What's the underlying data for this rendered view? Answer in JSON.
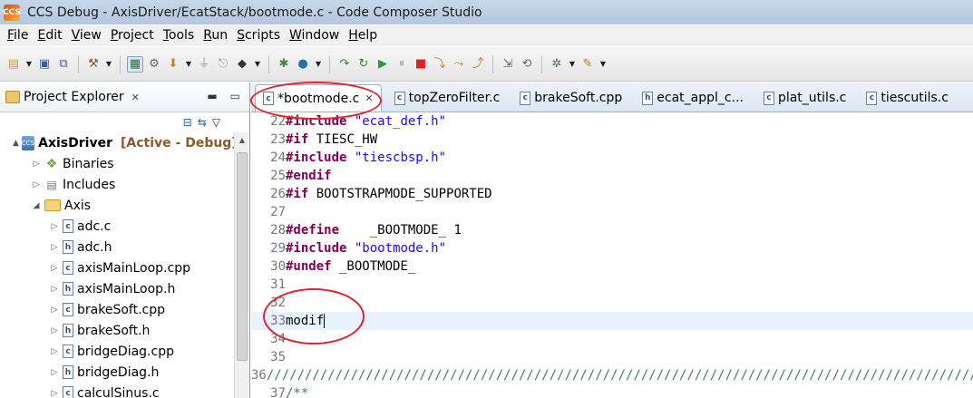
{
  "window": {
    "title": "CCS Debug - AxisDriver/EcatStack/bootmode.c - Code Composer Studio",
    "app_icon": "ccs-icon"
  },
  "menu": [
    "File",
    "Edit",
    "View",
    "Project",
    "Tools",
    "Run",
    "Scripts",
    "Window",
    "Help"
  ],
  "explorer": {
    "title": "Project Explorer",
    "tree": [
      {
        "label": "AxisDriver",
        "suffix": "[Active - Debug]",
        "icon": "project",
        "arrow": "▲",
        "indent": 0
      },
      {
        "label": "Binaries",
        "icon": "binaries",
        "arrow": "▷",
        "indent": 1
      },
      {
        "label": "Includes",
        "icon": "includes",
        "arrow": "▷",
        "indent": 1
      },
      {
        "label": "Axis",
        "icon": "folder",
        "arrow": "◢",
        "indent": 1
      },
      {
        "label": "adc.c",
        "icon": "c",
        "arrow": "▷",
        "indent": 2
      },
      {
        "label": "adc.h",
        "icon": "h",
        "arrow": "▷",
        "indent": 2
      },
      {
        "label": "axisMainLoop.cpp",
        "icon": "c",
        "arrow": "▷",
        "indent": 2
      },
      {
        "label": "axisMainLoop.h",
        "icon": "h",
        "arrow": "▷",
        "indent": 2
      },
      {
        "label": "brakeSoft.cpp",
        "icon": "c",
        "arrow": "▷",
        "indent": 2
      },
      {
        "label": "brakeSoft.h",
        "icon": "h",
        "arrow": "▷",
        "indent": 2
      },
      {
        "label": "bridgeDiag.cpp",
        "icon": "c",
        "arrow": "▷",
        "indent": 2
      },
      {
        "label": "bridgeDiag.h",
        "icon": "h",
        "arrow": "▷",
        "indent": 2
      },
      {
        "label": "calculSinus.c",
        "icon": "c",
        "arrow": "▷",
        "indent": 2
      }
    ]
  },
  "editor": {
    "tabs": [
      {
        "label": "*bootmode.c",
        "icon": "c",
        "active": true,
        "closable": true
      },
      {
        "label": "topZeroFilter.c",
        "icon": "c"
      },
      {
        "label": "brakeSoft.cpp",
        "icon": "c"
      },
      {
        "label": "ecat_appl_c...",
        "icon": "h"
      },
      {
        "label": "plat_utils.c",
        "icon": "c"
      },
      {
        "label": "tiescutils.c",
        "icon": "c"
      }
    ],
    "lines": [
      {
        "n": "22",
        "parts": [
          [
            "kw",
            "#include"
          ],
          [
            "",
            ""
          ],
          [
            "str",
            " \"ecat_def.h\""
          ]
        ]
      },
      {
        "n": "23",
        "parts": [
          [
            "kw",
            "#if"
          ],
          [
            "",
            " TIESC_HW"
          ]
        ]
      },
      {
        "n": "24",
        "parts": [
          [
            "kw",
            "#include"
          ],
          [
            "str",
            " \"tiescbsp.h\""
          ]
        ]
      },
      {
        "n": "25",
        "parts": [
          [
            "kw",
            "#endif"
          ]
        ]
      },
      {
        "n": "26",
        "parts": [
          [
            "kw",
            "#if"
          ],
          [
            "",
            " BOOTSTRAPMODE_SUPPORTED"
          ]
        ]
      },
      {
        "n": "27",
        "parts": []
      },
      {
        "n": "28",
        "parts": [
          [
            "kw",
            "#define"
          ],
          [
            "",
            "    _BOOTMODE_ 1"
          ]
        ]
      },
      {
        "n": "29",
        "parts": [
          [
            "kw",
            "#include"
          ],
          [
            "str",
            " \"bootmode.h\""
          ]
        ]
      },
      {
        "n": "30",
        "parts": [
          [
            "kw",
            "#undef"
          ],
          [
            "",
            " _BOOTMODE_"
          ]
        ]
      },
      {
        "n": "31",
        "parts": []
      },
      {
        "n": "32",
        "parts": []
      },
      {
        "n": "33",
        "parts": [
          [
            "",
            "modif"
          ]
        ],
        "current": true
      },
      {
        "n": "34",
        "parts": []
      },
      {
        "n": "35",
        "parts": []
      },
      {
        "n": "36",
        "parts": [
          [
            "cmt",
            "////////////////////////////////////////////////////////////////////////////////////////////////"
          ]
        ]
      },
      {
        "n": "37",
        "parts": [
          [
            "cmt",
            "/**"
          ]
        ]
      }
    ]
  },
  "colors": {
    "annotation": "#e0232d",
    "keyword": "#7f0055",
    "string": "#2a00ff",
    "comment": "#3f7f5f"
  }
}
